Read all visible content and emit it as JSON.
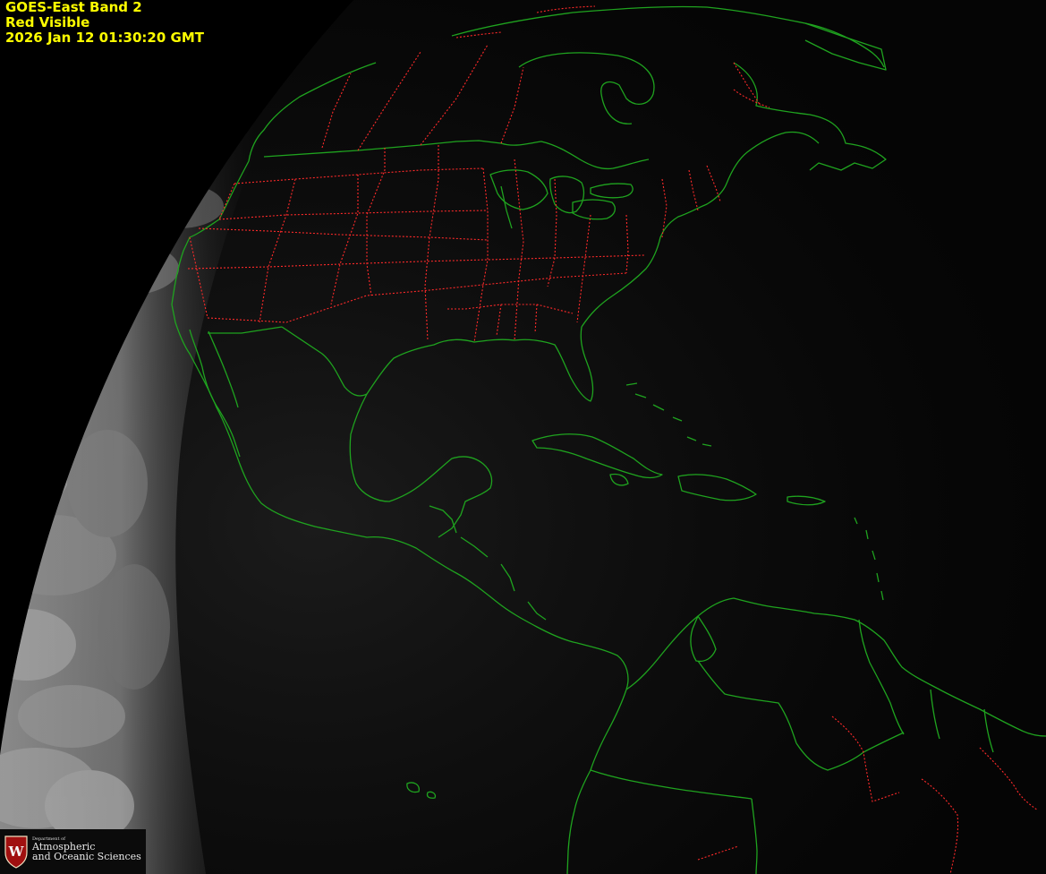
{
  "title": {
    "line1": "GOES-East Band 2",
    "line2": "Red Visible",
    "line3": "2026 Jan 12  01:30:20 GMT"
  },
  "colors": {
    "caption": "#ffff00",
    "coastline": "#1fa31f",
    "state_border": "#ff2a2a",
    "space": "#000000"
  },
  "logo": {
    "crest_letter": "W",
    "line1": "Department of",
    "line2": "Atmospheric",
    "line3": "and Oceanic Sciences"
  }
}
